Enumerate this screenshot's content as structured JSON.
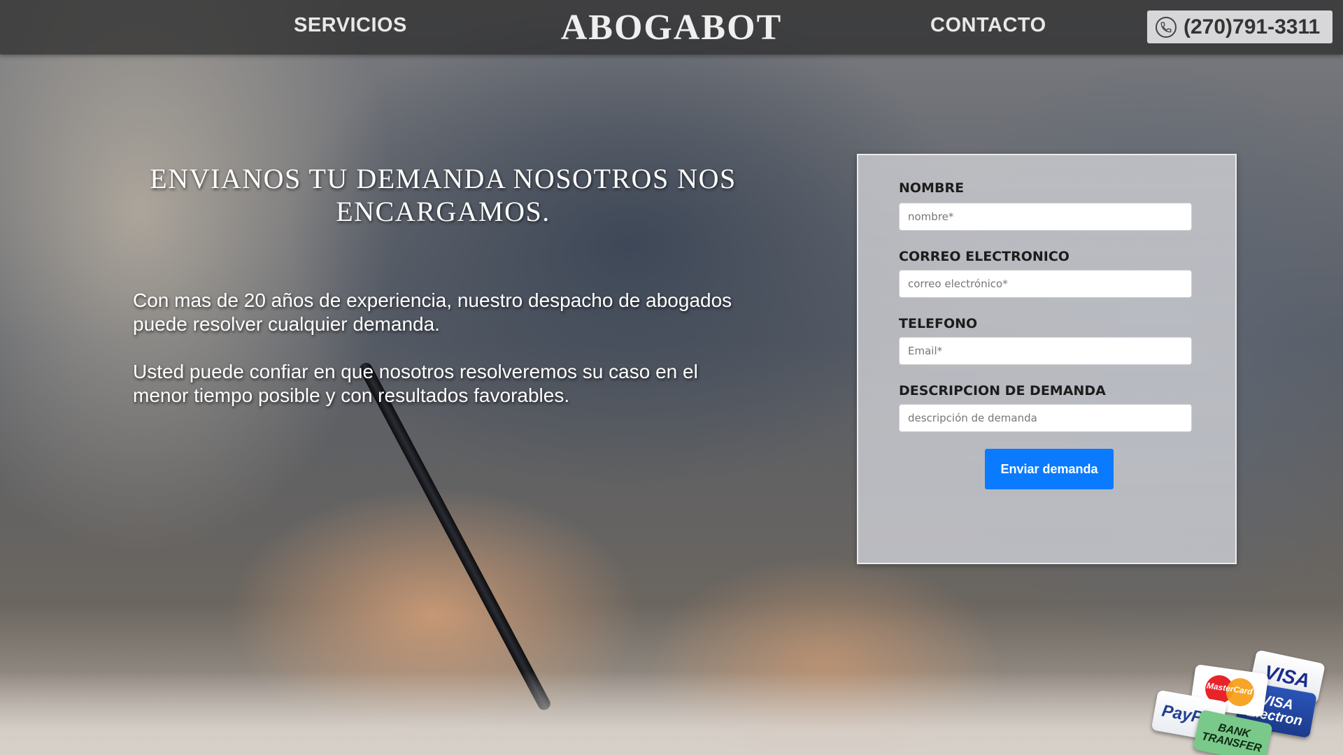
{
  "header": {
    "nav_servicios": "SERVICIOS",
    "logo": "ABOGABOT",
    "nav_contacto": "CONTACTO",
    "phone": "(270)791-3311",
    "phone_icon": "phone-icon"
  },
  "hero": {
    "title": "ENVIANOS TU DEMANDA NOSOTROS NOS ENCARGAMOS.",
    "paragraph_1": "Con mas de 20 años de experiencia, nuestro despacho de abogados puede resolver cualquier demanda.",
    "paragraph_2": "Usted puede confiar en que nosotros resolveremos su caso en el menor tiempo posible y con resultados favorables."
  },
  "form": {
    "fields": [
      {
        "label": "NOMBRE",
        "placeholder": "nombre*",
        "value": ""
      },
      {
        "label": "CORREO ELECTRONICO",
        "placeholder": "correo electrónico*",
        "value": ""
      },
      {
        "label": "TELEFONO",
        "placeholder": "Email*",
        "value": ""
      },
      {
        "label": "DESCRIPCION DE DEMANDA",
        "placeholder": "descripción de demanda",
        "value": ""
      }
    ],
    "submit_label": "Enviar demanda"
  },
  "payments": {
    "visa": "VISA",
    "visa_electron_top": "VISA",
    "visa_electron_bottom": "Electron",
    "mastercard": "MasterCard",
    "paypal": "PayPal",
    "bank_top": "BANK",
    "bank_bottom": "TRANSFER"
  },
  "colors": {
    "submit_button": "#0a7bff",
    "header_bar": "#282828"
  }
}
